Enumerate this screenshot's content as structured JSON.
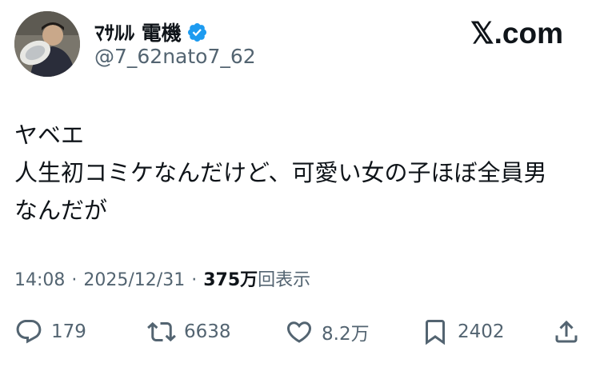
{
  "author": {
    "display_name": "ﾏｻﾙﾙ 電機",
    "handle": "@7_62nato7_62",
    "verified_icon": "verified-badge-icon",
    "avatar_icon": "avatar-photo"
  },
  "brand": "𝕏.com",
  "tweet": {
    "lines": [
      "ヤベエ",
      "人生初コミケなんだけど、可愛い女の子ほぼ全員男",
      "なんだが"
    ]
  },
  "meta": {
    "time": "14:08",
    "separator": "·",
    "date": "2025/12/31",
    "views_count": "375万",
    "views_label": "回表示"
  },
  "actions": {
    "reply": {
      "icon": "reply-icon",
      "count": "179"
    },
    "repost": {
      "icon": "repost-icon",
      "count": "6638"
    },
    "like": {
      "icon": "heart-icon",
      "count": "8.2万"
    },
    "bookmark": {
      "icon": "bookmark-icon",
      "count": "2402"
    },
    "share": {
      "icon": "share-icon"
    }
  },
  "colors": {
    "text": "#0f1419",
    "secondary": "#536471",
    "verified": "#1d9bf0"
  }
}
